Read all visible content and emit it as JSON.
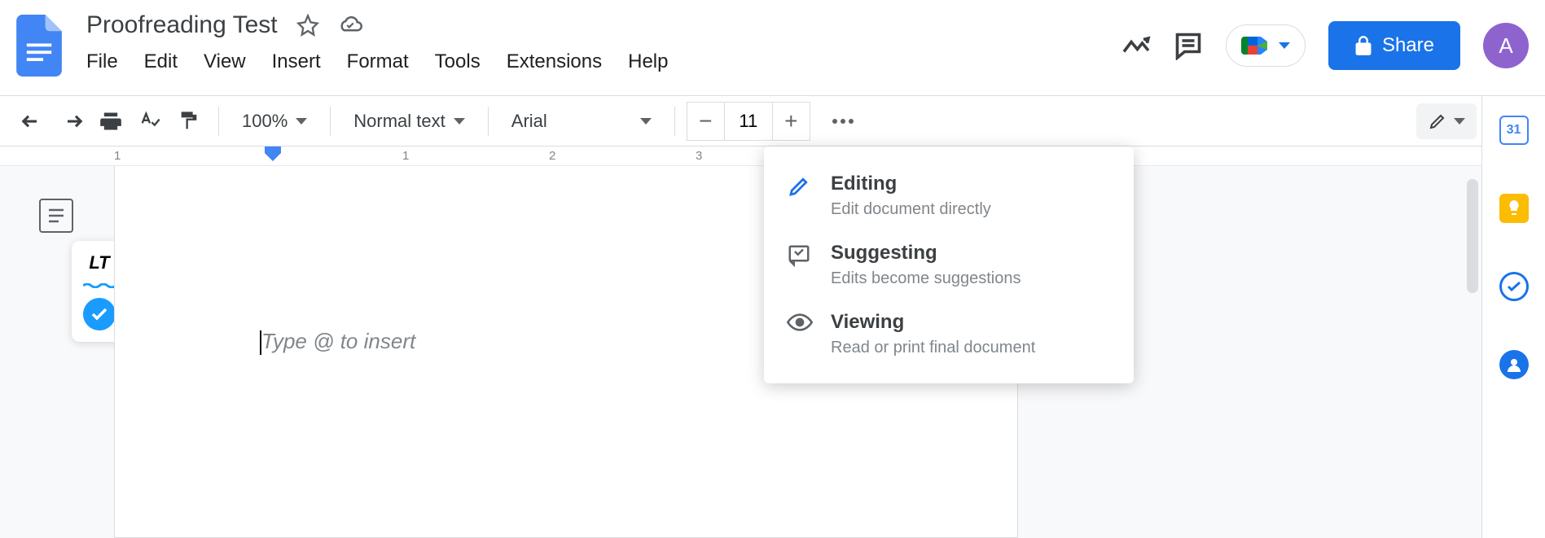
{
  "document": {
    "title": "Proofreading Test",
    "placeholder": "Type @ to insert"
  },
  "menus": [
    "File",
    "Edit",
    "View",
    "Insert",
    "Format",
    "Tools",
    "Extensions",
    "Help"
  ],
  "toolbar": {
    "zoom": "100%",
    "style": "Normal text",
    "font": "Arial",
    "font_size": "11"
  },
  "share": {
    "label": "Share"
  },
  "avatar": {
    "letter": "A"
  },
  "mode_menu": [
    {
      "title": "Editing",
      "desc": "Edit document directly",
      "icon": "pencil",
      "active": true
    },
    {
      "title": "Suggesting",
      "desc": "Edits become suggestions",
      "icon": "suggest",
      "active": false
    },
    {
      "title": "Viewing",
      "desc": "Read or print final document",
      "icon": "eye",
      "active": false
    }
  ],
  "ruler": {
    "numbers": [
      "1",
      "1",
      "2",
      "3"
    ]
  },
  "sidebar": {
    "calendar_day": "31"
  }
}
